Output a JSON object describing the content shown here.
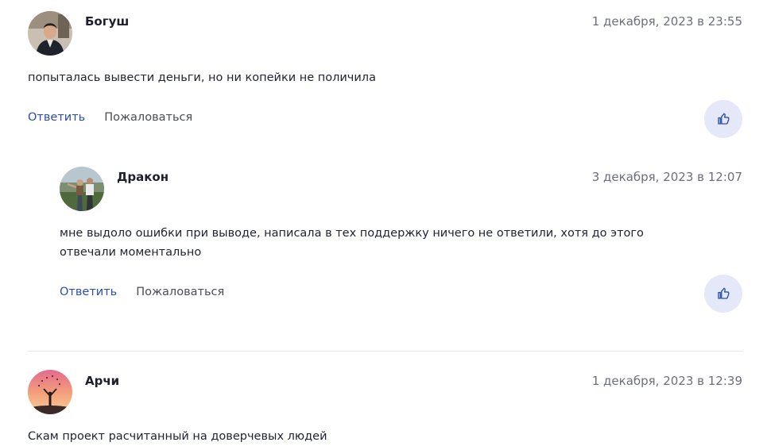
{
  "comments": [
    {
      "author": "Богуш",
      "date": "1 декабря, 2023 в 23:55",
      "text": "попыталась вывести деньги, но ни копейки не поличила",
      "reply_label": "Ответить",
      "report_label": "Пожаловаться"
    },
    {
      "author": "Дракон",
      "date": "3 декабря, 2023 в 12:07",
      "text": "мне выдоло ошибки при выводе, написала в тех поддержку ничего не ответили, хотя до этого отвечали моментально",
      "reply_label": "Ответить",
      "report_label": "Пожаловаться"
    },
    {
      "author": "Арчи",
      "date": "1 декабря, 2023 в 12:39",
      "text": "Скам проект расчитанный на доверчевых людей"
    }
  ],
  "colors": {
    "accent_link": "#2a4ea8",
    "like_bg": "#e4e8f8",
    "like_icon": "#2a4ea8",
    "divider": "#e6e7ec"
  },
  "icons": {
    "like": "thumbs-up-icon"
  }
}
